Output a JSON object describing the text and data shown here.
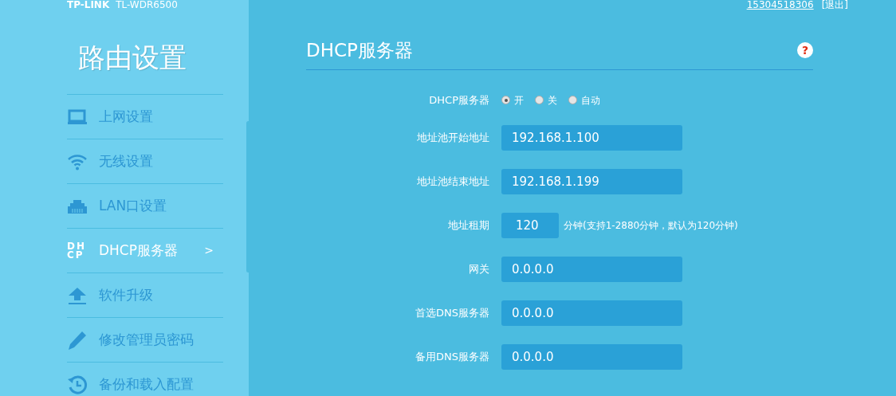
{
  "header": {
    "logo": "TP-LINK",
    "model": "TL-WDR6500",
    "account": "15304518306",
    "logout": "[退出]"
  },
  "sidebar": {
    "title": "路由设置",
    "items": [
      {
        "label": "上网设置",
        "selected": false
      },
      {
        "label": "无线设置",
        "selected": false
      },
      {
        "label": "LAN口设置",
        "selected": false
      },
      {
        "label": "DHCP服务器",
        "icon_text": [
          "DH",
          "CP"
        ],
        "arrow": ">",
        "selected": true
      },
      {
        "label": "软件升级",
        "selected": false
      },
      {
        "label": "修改管理员密码",
        "selected": false
      },
      {
        "label": "备份和载入配置",
        "selected": false
      }
    ]
  },
  "main": {
    "title": "DHCP服务器",
    "help": "?",
    "fields": [
      {
        "kind": "radio",
        "label": "DHCP服务器",
        "options": [
          {
            "label": "开",
            "selected": true
          },
          {
            "label": "关",
            "selected": false
          },
          {
            "label": "自动",
            "selected": false
          }
        ]
      },
      {
        "kind": "text",
        "label": "地址池开始地址",
        "value": "192.168.1.100"
      },
      {
        "kind": "text",
        "label": "地址池结束地址",
        "value": "192.168.1.199"
      },
      {
        "kind": "short",
        "label": "地址租期",
        "value": "120",
        "note": "分钟(支持1-2880分钟，默认为120分钟)"
      },
      {
        "kind": "text",
        "label": "网关",
        "value": "0.0.0.0"
      },
      {
        "kind": "text",
        "label": "首选DNS服务器",
        "value": "0.0.0.0"
      },
      {
        "kind": "text",
        "label": "备用DNS服务器",
        "value": "0.0.0.0"
      }
    ]
  }
}
